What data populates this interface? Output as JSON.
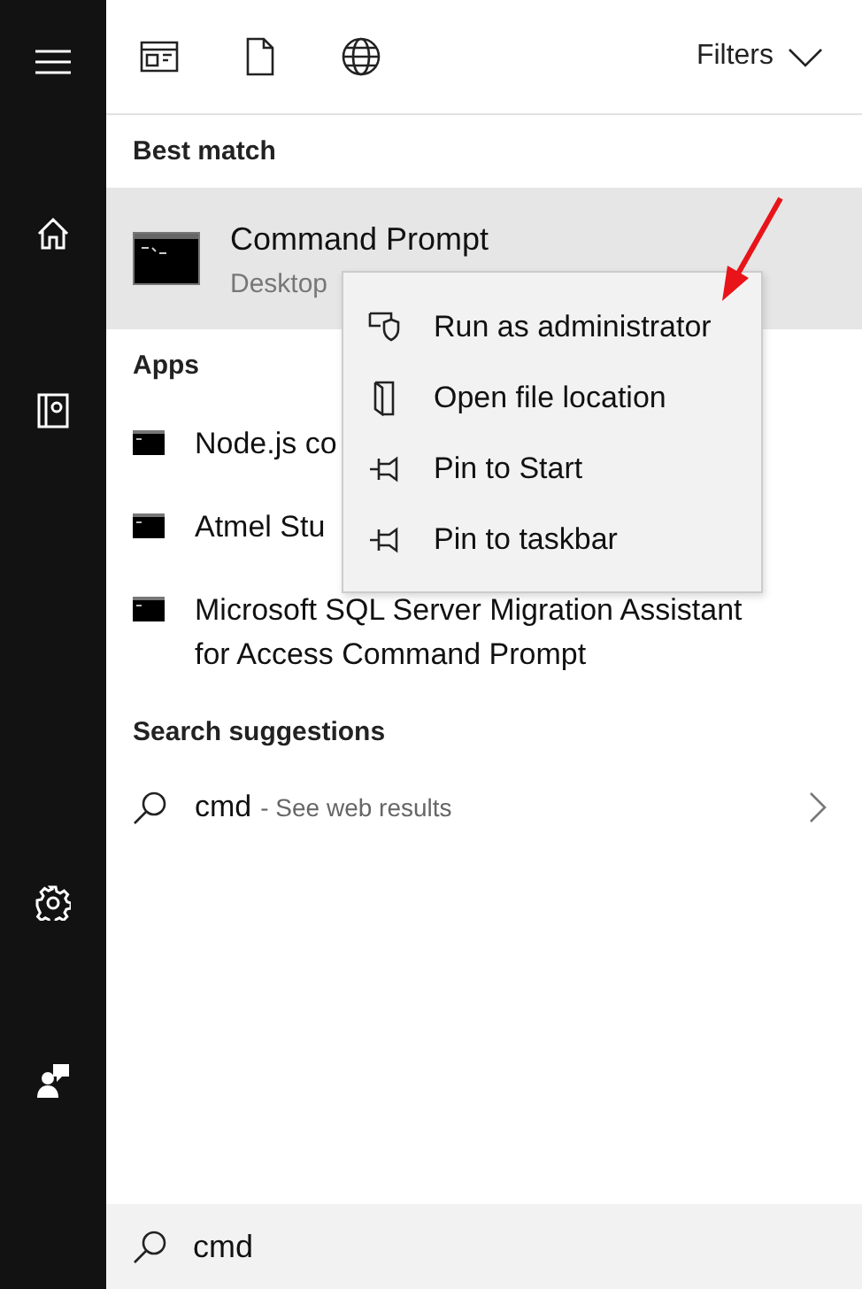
{
  "toolbar": {
    "filters_label": "Filters"
  },
  "best_match": {
    "heading": "Best match",
    "item": {
      "title": "Command Prompt",
      "subtitle": "Desktop",
      "selected": true
    }
  },
  "apps": {
    "heading": "Apps",
    "items": [
      {
        "label": "Node.js co"
      },
      {
        "label": "Atmel Stu"
      },
      {
        "label": "Microsoft SQL Server Migration Assistant for Access Command Prompt"
      }
    ]
  },
  "search_suggestions": {
    "heading": "Search suggestions",
    "items": [
      {
        "query": "cmd",
        "hint": "- See web results"
      }
    ]
  },
  "context_menu": {
    "items": [
      {
        "kind": "shield",
        "label": "Run as administrator"
      },
      {
        "kind": "folder",
        "label": "Open file location"
      },
      {
        "kind": "pin",
        "label": "Pin to Start"
      },
      {
        "kind": "pin",
        "label": "Pin to taskbar"
      }
    ]
  },
  "search_box": {
    "value": "cmd"
  }
}
